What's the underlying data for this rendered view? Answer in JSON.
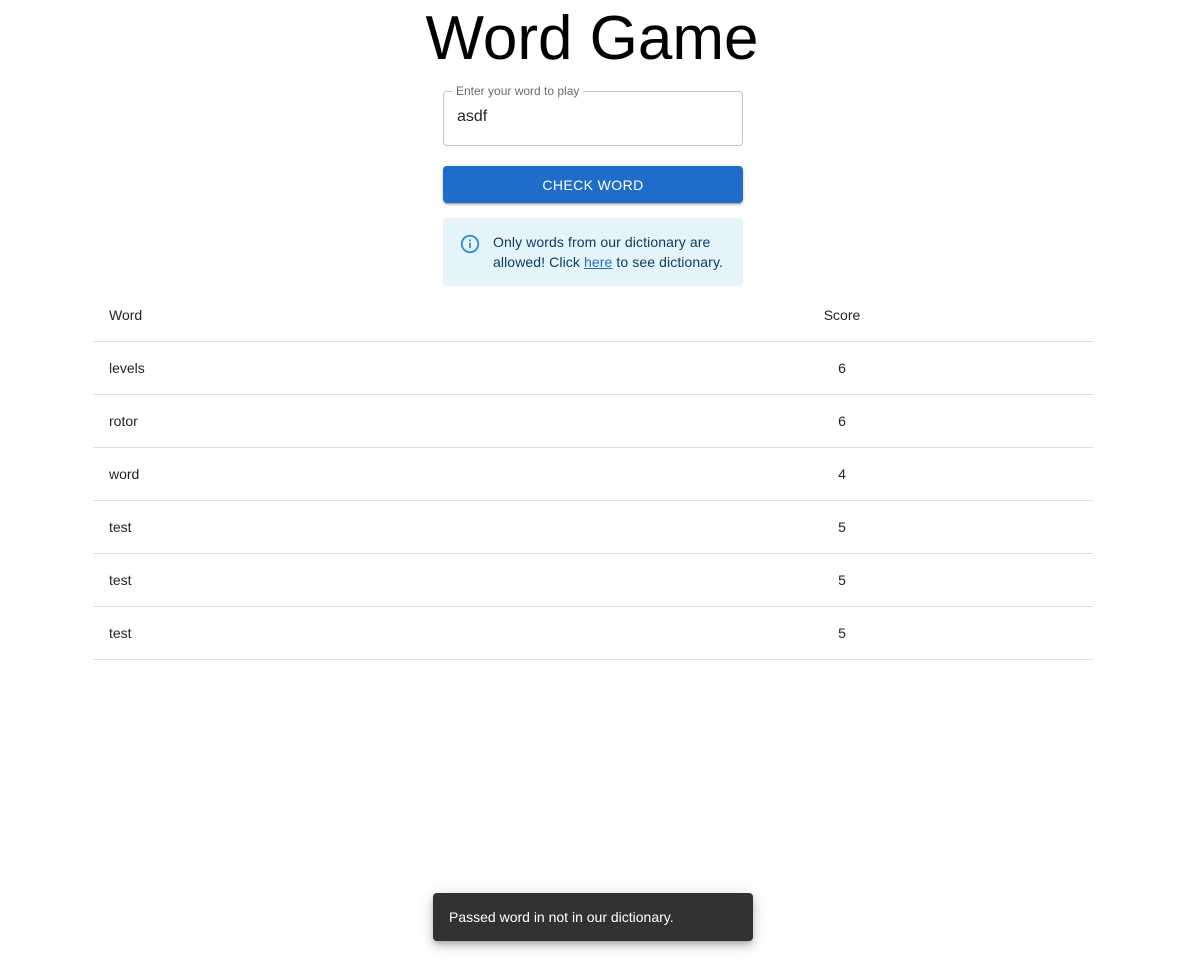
{
  "header": {
    "title": "Word Game"
  },
  "word_input": {
    "label": "Enter your word to play",
    "value": "asdf"
  },
  "check_button": {
    "label": "CHECK WORD"
  },
  "info_alert": {
    "text_before_link": "Only words from our dictionary are allowed! Click ",
    "link_text": "here",
    "text_after_link": " to see dictionary.",
    "icon": "info-icon"
  },
  "score_table": {
    "columns": [
      "Word",
      "Score"
    ],
    "rows": [
      {
        "word": "levels",
        "score": "6"
      },
      {
        "word": "rotor",
        "score": "6"
      },
      {
        "word": "word",
        "score": "4"
      },
      {
        "word": "test",
        "score": "5"
      },
      {
        "word": "test",
        "score": "5"
      },
      {
        "word": "test",
        "score": "5"
      }
    ]
  },
  "snackbar": {
    "message": "Passed word in not in our dictionary."
  },
  "colors": {
    "primary": "#1f6ccb",
    "info_background": "#e5f3fb",
    "info_text": "#0d3c61",
    "snackbar_background": "#323232"
  }
}
